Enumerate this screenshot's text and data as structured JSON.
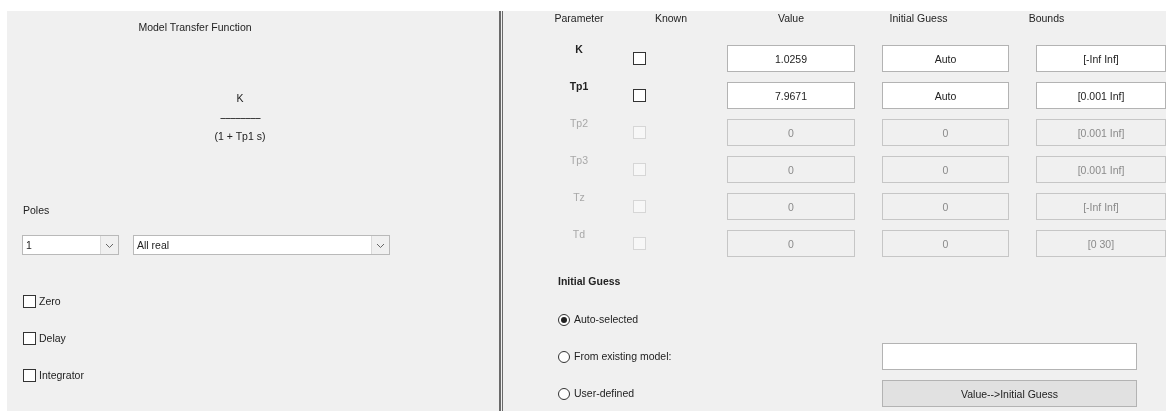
{
  "model_panel": {
    "title": "Model Transfer Function",
    "formula": {
      "numerator": "K",
      "divider": "----------------",
      "denominator": "(1 + Tp1 s)"
    },
    "poles_label": "Poles",
    "poles_count": {
      "value": "1"
    },
    "pole_type": {
      "value": "All real"
    },
    "options": [
      {
        "label": "Zero",
        "checked": false
      },
      {
        "label": "Delay",
        "checked": false
      },
      {
        "label": "Integrator",
        "checked": false
      }
    ]
  },
  "parameter_panel": {
    "columns": [
      "Parameter",
      "Known",
      "Value",
      "Initial Guess",
      "Bounds"
    ],
    "rows": [
      {
        "parameter": "K",
        "known": false,
        "disabled": false,
        "value": "1.0259",
        "initial_guess": "Auto",
        "bounds": "[-Inf Inf]"
      },
      {
        "parameter": "Tp1",
        "known": false,
        "disabled": false,
        "value": "7.9671",
        "initial_guess": "Auto",
        "bounds": "[0.001 Inf]"
      },
      {
        "parameter": "Tp2",
        "known": false,
        "disabled": true,
        "value": "0",
        "initial_guess": "0",
        "bounds": "[0.001 Inf]"
      },
      {
        "parameter": "Tp3",
        "known": false,
        "disabled": true,
        "value": "0",
        "initial_guess": "0",
        "bounds": "[0.001 Inf]"
      },
      {
        "parameter": "Tz",
        "known": false,
        "disabled": true,
        "value": "0",
        "initial_guess": "0",
        "bounds": "[-Inf Inf]"
      },
      {
        "parameter": "Td",
        "known": false,
        "disabled": true,
        "value": "0",
        "initial_guess": "0",
        "bounds": "[0 30]"
      }
    ],
    "initial_guess": {
      "title": "Initial Guess",
      "options": [
        {
          "label": "Auto-selected",
          "selected": true
        },
        {
          "label": "From existing model:",
          "selected": false
        },
        {
          "label": "User-defined",
          "selected": false
        }
      ]
    },
    "transfer_button": "Value-->Initial Guess"
  }
}
